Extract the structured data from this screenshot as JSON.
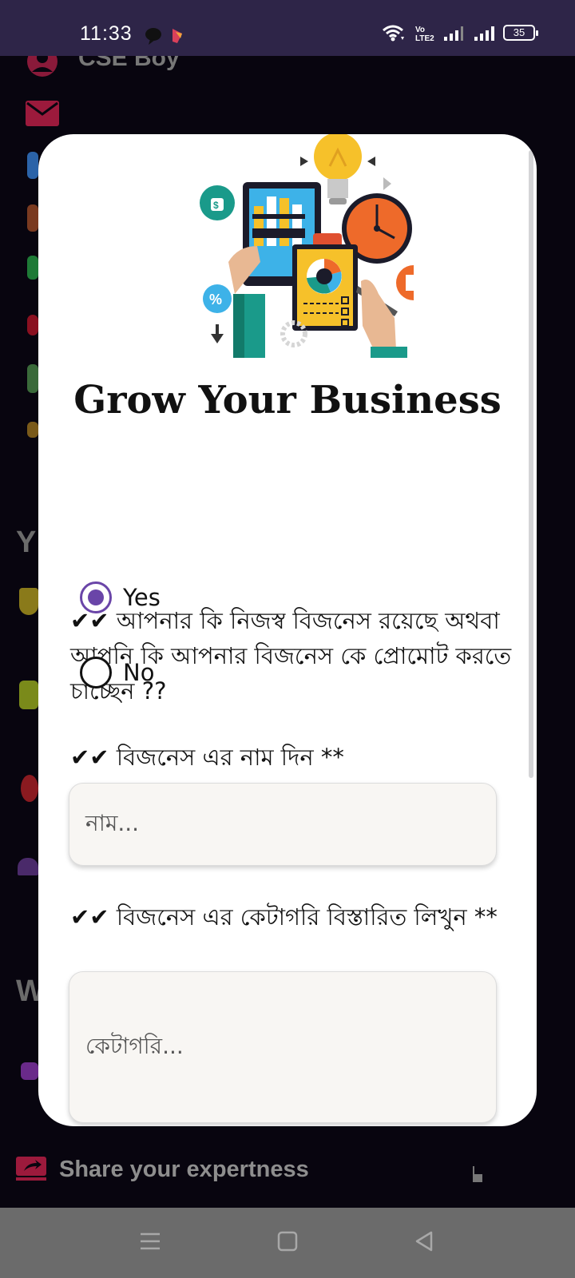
{
  "status_bar": {
    "time": "11:33",
    "battery": "35",
    "icons": [
      "chat-bubble-icon",
      "app-notification-icon",
      "wifi-icon",
      "volte-icon",
      "signal-icon",
      "signal-icon",
      "battery-icon"
    ]
  },
  "background": {
    "user_name": "CSE Boy",
    "section_y": "Y",
    "section_w": "W",
    "share_label": "Share your expertness"
  },
  "dialog": {
    "title": "Grow Your Business",
    "question_1": "✔✔ আপনার কি নিজস্ব বিজনেস রয়েছে অথবা আপনি কি আপনার বিজনেস কে প্রোমোট করতে চাচ্ছেন ??",
    "options": [
      {
        "label": "Yes",
        "checked": true
      },
      {
        "label": "No",
        "checked": false
      }
    ],
    "question_2": "✔✔ বিজনেস এর নাম দিন **",
    "name_placeholder": "নাম...",
    "question_3": "✔✔ বিজনেস এর কেটাগরি বিস্তারিত লিখুন **",
    "category_placeholder": "কেটাগরি..."
  },
  "colors": {
    "accent": "#6a45a8",
    "status_bar": "#2e2548",
    "nav_bar": "#6b6b6b"
  },
  "nav_bar": {
    "buttons": [
      "menu-icon",
      "home-icon",
      "back-icon"
    ]
  }
}
